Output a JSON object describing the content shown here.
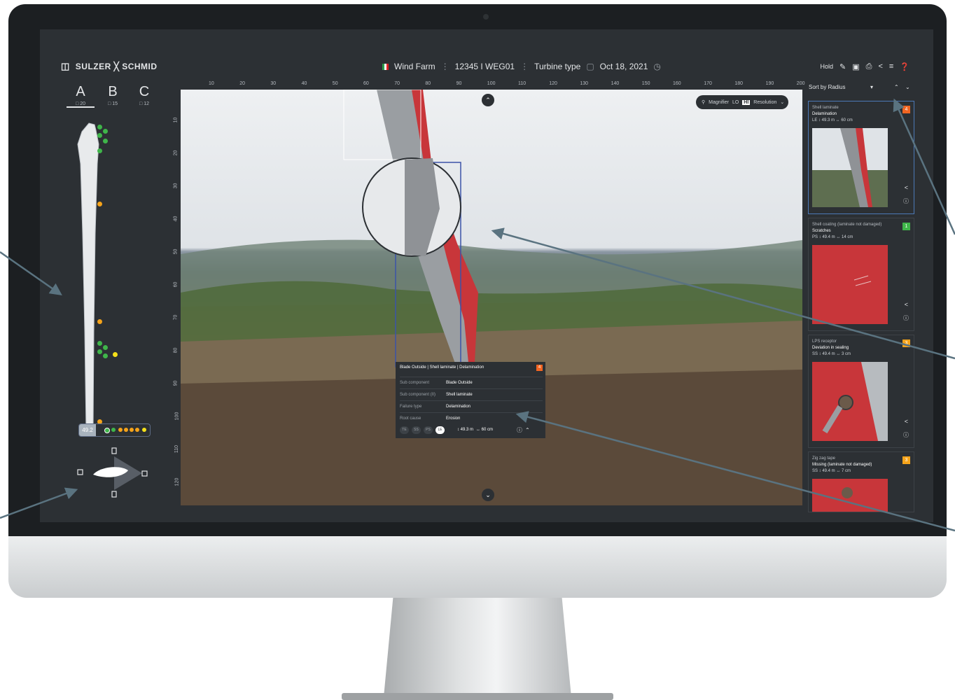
{
  "header": {
    "logo": "SULZER ╳ SCHMID",
    "wind_farm": "Wind Farm",
    "turbine_id": "12345 I WEG01",
    "turbine_type": "Turbine type",
    "date": "Oct 18, 2021",
    "hold_label": "Hold"
  },
  "blades": [
    {
      "label": "A",
      "count": "20"
    },
    {
      "label": "B",
      "count": "15"
    },
    {
      "label": "C",
      "count": "12"
    }
  ],
  "selected_radius": "49.2",
  "ruler": {
    "top": [
      "10",
      "20",
      "30",
      "40",
      "50",
      "60",
      "70",
      "80",
      "90",
      "100",
      "110",
      "120",
      "130",
      "140",
      "150",
      "160",
      "170",
      "180",
      "190",
      "200"
    ],
    "left": [
      "10",
      "20",
      "30",
      "40",
      "50",
      "60",
      "70",
      "80",
      "90",
      "100",
      "110",
      "120"
    ]
  },
  "magnifier": {
    "label": "Magnifier",
    "lo": "LO",
    "hi": "HI",
    "resolution": "Resolution"
  },
  "damage_popup": {
    "title": "Blade Outside | Shell laminate | Delamination",
    "severity": "4",
    "rows": [
      {
        "key": "Sub component",
        "value": "Blade Outside"
      },
      {
        "key": "Sub component (II)",
        "value": "Shell laminate"
      },
      {
        "key": "Failure type",
        "value": "Delamination"
      },
      {
        "key": "Root cause",
        "value": "Erosion"
      }
    ],
    "sides": [
      "TE",
      "SS",
      "PS",
      "LE"
    ],
    "radius": "↕ 49.3 m",
    "length": "↔ 60 cm"
  },
  "sort_label": "Sort by Radius",
  "findings": [
    {
      "component": "Shell laminate",
      "type": "Delamination",
      "meta": "LE  ↕ 49.3 m  ↔ 60 cm",
      "severity": "4",
      "color": "#f26522"
    },
    {
      "component": "Shell coating (laminate not damaged)",
      "type": "Scratches",
      "meta": "PS  ↕ 49.4 m  ↔ 14 cm",
      "severity": "1",
      "color": "#3fb54a"
    },
    {
      "component": "LPS receptor",
      "type": "Deviation in sealing",
      "meta": "SS  ↕ 49.4 m  ↔ 3 cm",
      "severity": "3",
      "color": "#f5a31a"
    },
    {
      "component": "Zig zag tape",
      "type": "Missing (laminate not damaged)",
      "meta": "SS  ↕ 49.4 m  ↔ 7 cm",
      "severity": "3",
      "color": "#f5a31a"
    }
  ],
  "colors": {
    "accent": "#4c79b7",
    "app_bg": "#2c3034",
    "blade_red": "#c8363a"
  }
}
